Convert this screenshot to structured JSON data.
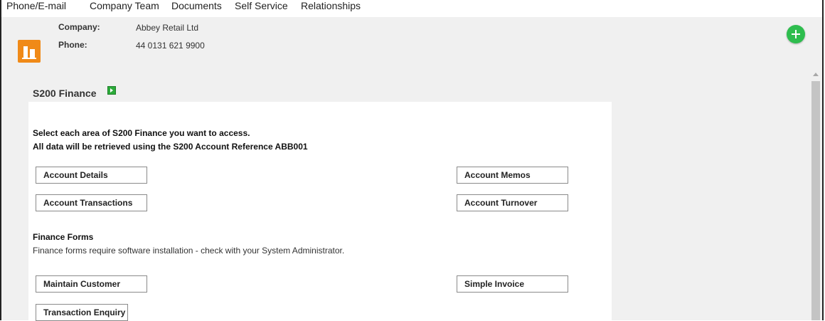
{
  "nav": {
    "tabs": [
      "Phone/E-mail",
      "Company Team",
      "Documents",
      "Self Service",
      "Relationships"
    ]
  },
  "company": {
    "label": "Company:",
    "value": "Abbey Retail Ltd",
    "phone_label": "Phone:",
    "phone_value": "44 0131 621 9900"
  },
  "section": {
    "title": "S200 Finance",
    "instruction_1": "Select each area of S200 Finance you want to access.",
    "instruction_2": "All data will be retrieved using the S200 Account Reference ABB001",
    "buttons": {
      "account_details": "Account Details",
      "account_memos": "Account Memos",
      "account_transactions": "Account Transactions",
      "account_turnover": "Account Turnover"
    },
    "forms_heading": "Finance Forms",
    "forms_note": "Finance forms require software installation - check with your System Administrator.",
    "form_buttons": {
      "maintain_customer": "Maintain Customer",
      "simple_invoice": "Simple Invoice",
      "transaction_enquiry": "Transaction Enquiry"
    }
  },
  "colors": {
    "logo": "#f08a18",
    "add_button": "#2ebd4e",
    "play_icon": "#2cab3a",
    "content_bg": "#f0f0f0"
  },
  "icons": [
    "add-circle-icon",
    "company-building-icon",
    "play-icon",
    "scroll-up-arrow-icon"
  ]
}
